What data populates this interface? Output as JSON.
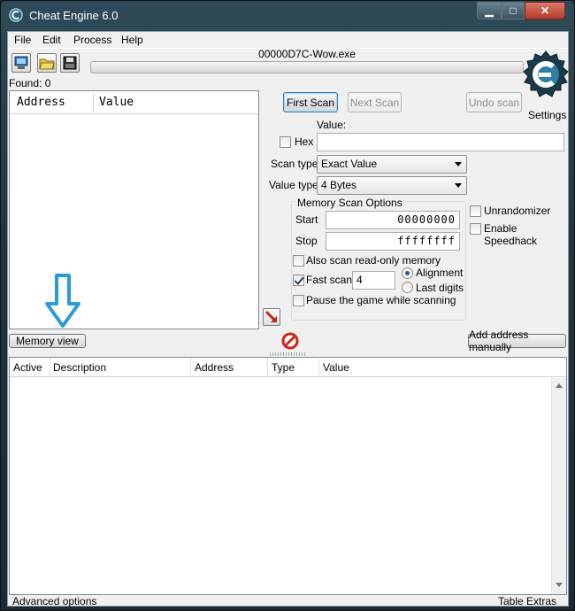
{
  "window": {
    "title": "Cheat Engine 6.0",
    "min_glyph": "▁",
    "max_glyph": "□",
    "close_glyph": "✕"
  },
  "menu": {
    "items": [
      "File",
      "Edit",
      "Process",
      "Help"
    ]
  },
  "toolbar": {
    "process_name": "00000D7C-Wow.exe",
    "found_label": "Found: 0"
  },
  "logo": {
    "settings_label": "Settings",
    "icon": "cheat-engine-logo"
  },
  "found_list": {
    "columns": [
      "Address",
      "Value"
    ]
  },
  "scan": {
    "first_scan": "First Scan",
    "next_scan": "Next Scan",
    "undo_scan": "Undo scan",
    "value_label": "Value:",
    "value": "",
    "hex_label": "Hex",
    "hex_checked": false,
    "scan_type_label": "Scan type",
    "scan_type": "Exact Value",
    "value_type_label": "Value type",
    "value_type": "4 Bytes"
  },
  "memory_options": {
    "group_label": "Memory Scan Options",
    "start_label": "Start",
    "start_value": "00000000",
    "stop_label": "Stop",
    "stop_value": "ffffffff",
    "readonly_label": "Also scan read-only memory",
    "readonly_checked": false,
    "fastscan_label": "Fast scan",
    "fastscan_checked": true,
    "fastscan_value": "4",
    "alignment_label": "Alignment",
    "lastdigits_label": "Last digits",
    "alignment_selected": true,
    "pause_label": "Pause the game while scanning",
    "pause_checked": false
  },
  "extra_options": {
    "unrandomizer_label": "Unrandomizer",
    "speedhack_label": "Enable Speedhack"
  },
  "actions": {
    "memory_view": "Memory view",
    "add_address_manually": "Add address manually"
  },
  "address_list": {
    "columns": [
      "Active",
      "Description",
      "Address",
      "Type",
      "Value"
    ]
  },
  "footer": {
    "advanced_options": "Advanced options",
    "table_extras": "Table Extras"
  },
  "colors": {
    "annotation_arrow": "#2a9bd8",
    "stop_icon": "#d0261b"
  }
}
